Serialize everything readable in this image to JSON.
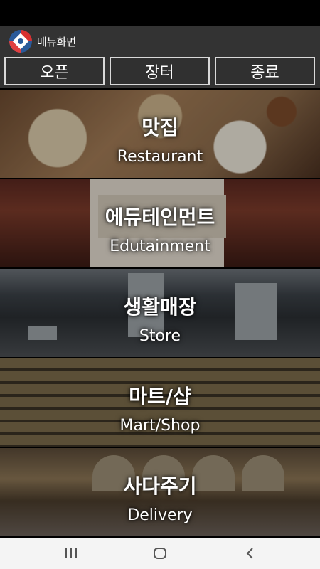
{
  "app": {
    "title": "메뉴화면"
  },
  "toolbar": {
    "open_label": "오픈",
    "market_label": "장터",
    "exit_label": "종료"
  },
  "menu": {
    "items": [
      {
        "title": "맛집",
        "subtitle": "Restaurant"
      },
      {
        "title": "에듀테인먼트",
        "subtitle": "Edutainment"
      },
      {
        "title": "생활매장",
        "subtitle": "Store"
      },
      {
        "title": "마트/샵",
        "subtitle": "Mart/Shop"
      },
      {
        "title": "사다주기",
        "subtitle": "Delivery"
      }
    ]
  },
  "navigation": {
    "recents_icon": "recent-apps-icon",
    "home_icon": "home-icon",
    "back_icon": "back-icon"
  },
  "colors": {
    "app_bar": "#333333",
    "button_border": "#d9d9d9",
    "nav_bar": "#f4f4f4"
  }
}
